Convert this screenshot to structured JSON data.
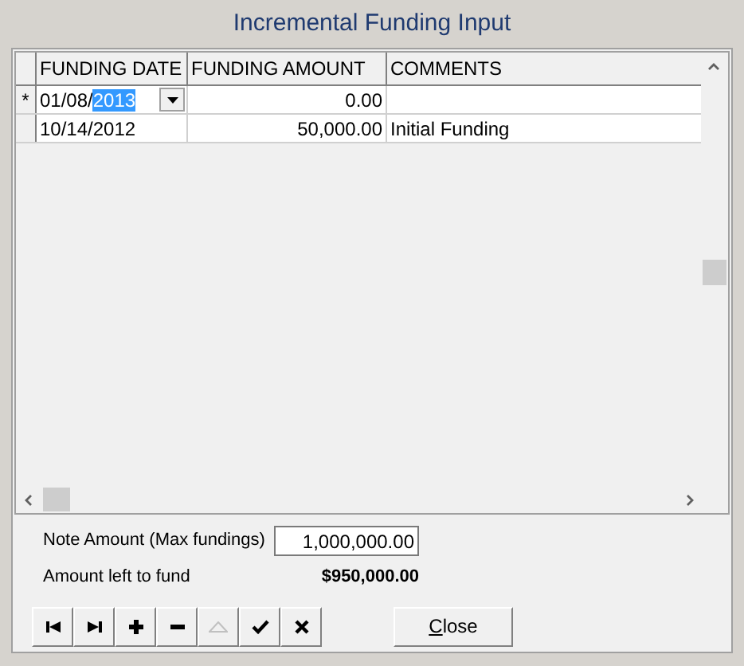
{
  "window": {
    "title": "Incremental Funding Input"
  },
  "table": {
    "columns": [
      "FUNDING DATE",
      "FUNDING AMOUNT",
      "COMMENTS"
    ],
    "rows": [
      {
        "indicator": "*",
        "date_parts": [
          {
            "text": "01/08/",
            "selected": false
          },
          {
            "text": "2013",
            "selected": true
          }
        ],
        "editing": true,
        "amount": "0.00",
        "comments": ""
      },
      {
        "indicator": "",
        "date_parts": [
          {
            "text": "10/14/2012",
            "selected": false
          }
        ],
        "editing": false,
        "amount": "50,000.00",
        "comments": "Initial Funding"
      }
    ]
  },
  "note_amount": {
    "label": "Note Amount (Max fundings)",
    "value": "1,000,000.00"
  },
  "amount_left": {
    "label": "Amount left to fund",
    "value": "$950,000.00"
  },
  "navigator": [
    {
      "kind": "first",
      "disabled": false
    },
    {
      "kind": "last",
      "disabled": false
    },
    {
      "kind": "add",
      "disabled": false
    },
    {
      "kind": "delete",
      "disabled": false
    },
    {
      "kind": "edit",
      "disabled": true
    },
    {
      "kind": "post",
      "disabled": false
    },
    {
      "kind": "cancel",
      "disabled": false
    }
  ],
  "close_button": {
    "label_parts": [
      {
        "text": "C",
        "underlined": true
      },
      {
        "text": "lose",
        "underlined": false
      }
    ]
  }
}
